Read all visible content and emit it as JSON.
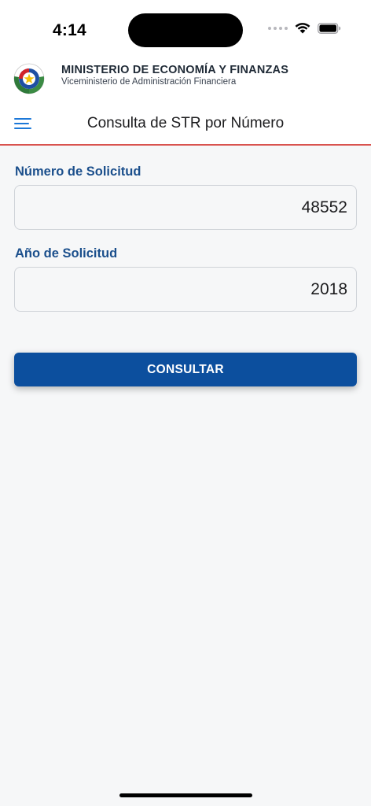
{
  "status_bar": {
    "time": "4:14"
  },
  "header": {
    "title": "MINISTERIO DE ECONOMÍA Y FINANZAS",
    "subtitle": "Viceministerio de Administración Financiera"
  },
  "navbar": {
    "title": "Consulta de STR por Número"
  },
  "form": {
    "numero": {
      "label": "Número de Solicitud",
      "value": "48552"
    },
    "anio": {
      "label": "Año de Solicitud",
      "value": "2018"
    },
    "submit_label": "CONSULTAR"
  },
  "icons": {
    "menu": "hamburger-menu-icon",
    "seal": "national-seal-icon",
    "wifi": "wifi-icon",
    "battery": "battery-icon"
  },
  "colors": {
    "primary": "#0c4f9e",
    "label": "#1b4f8c",
    "menu_icon": "#1c78d8",
    "divider": "#d9534f",
    "background": "#f6f7f8"
  }
}
